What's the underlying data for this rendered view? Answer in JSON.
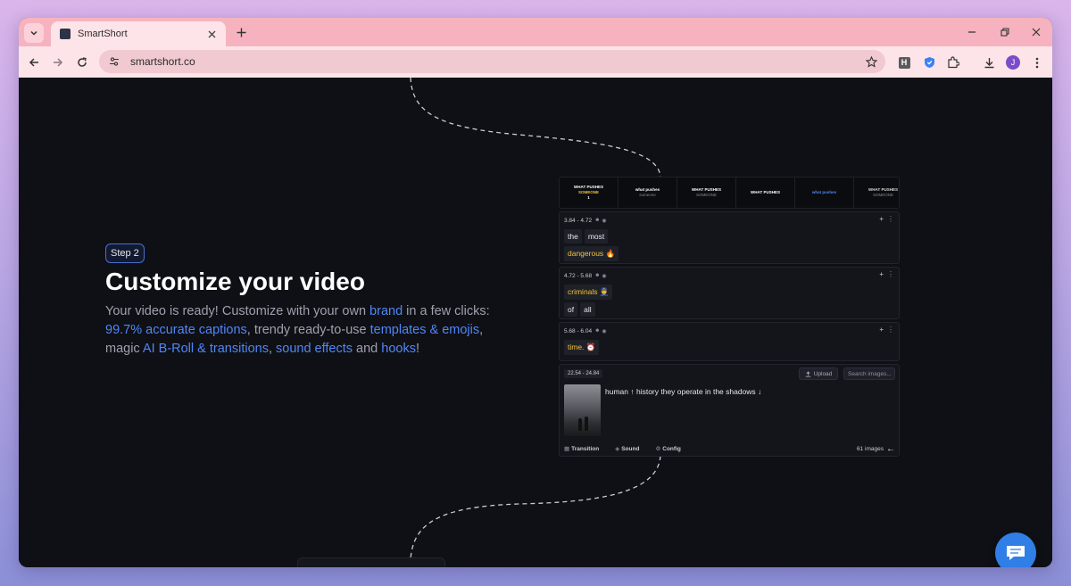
{
  "browser": {
    "tab_title": "SmartShort",
    "url": "smartshort.co",
    "extension_h_label": "H",
    "profile_initial": "J"
  },
  "hero": {
    "step_label": "Step 2",
    "heading": "Customize your video",
    "desc_parts": {
      "p1": "Your video is ready! Customize with your own ",
      "brand": "brand",
      "p2": " in a few clicks: ",
      "captions": "99.7% accurate captions",
      "p3": ", trendy ready-to-use ",
      "templates": "templates & emojis",
      "p4": ", magic ",
      "broll": "AI B-Roll & transitions",
      "p5": ", ",
      "sound": "sound effects",
      "p6": " and ",
      "hooks": "hooks",
      "p7": "!"
    }
  },
  "editor": {
    "thumbnails": [
      {
        "line1": "WHAT PUSHES",
        "line2": "SOMEONE",
        "line3": "1"
      },
      {
        "line1": "what pushes",
        "line2": "someone",
        "line3": ""
      },
      {
        "line1": "WHAT PUSHES",
        "line2": "SOMEONE",
        "line3": ""
      },
      {
        "line1": "WHAT PUSHES",
        "line2": "",
        "line3": ""
      },
      {
        "line1": "what pushes",
        "line2": "",
        "line3": ""
      },
      {
        "line1": "WHAT PUSHES",
        "line2": "SOMEONE",
        "line3": ""
      }
    ],
    "segments": [
      {
        "time": "3.84 - 4.72",
        "words": [
          "the",
          "most",
          "dangerous 🔥"
        ],
        "highlight": [
          2
        ]
      },
      {
        "time": "4.72 - 5.68",
        "words": [
          "criminals 👮",
          "of",
          "all"
        ],
        "highlight": [
          0
        ]
      },
      {
        "time": "5.68 - 6.04",
        "words": [
          "time. ⏰"
        ],
        "highlight": [
          0
        ]
      }
    ],
    "broll": {
      "time": "22.54 - 24.84",
      "upload_label": "Upload",
      "search_placeholder": "Search images...",
      "text": "human ↑ history they operate in the shadows ↓",
      "transition_label": "Transition",
      "sound_label": "Sound",
      "config_label": "Config",
      "image_count": "61 images"
    }
  },
  "colors": {
    "accent_blue": "#4f86f7",
    "highlight_yellow": "#f0c23a",
    "tab_bar_pink": "#f6b3bf",
    "page_bg": "#0f1015",
    "chat_button": "#2f7fe6"
  }
}
